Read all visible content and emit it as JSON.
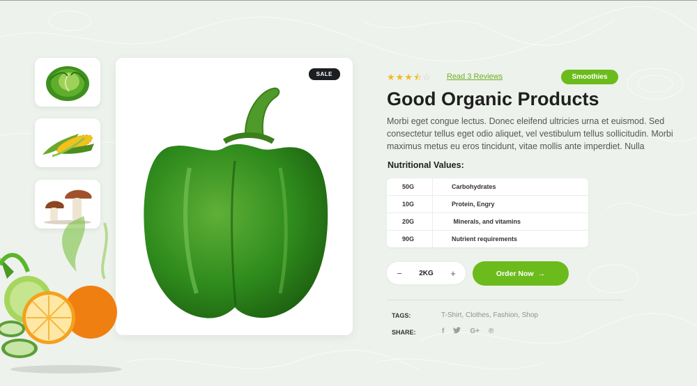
{
  "product": {
    "badge": "SALE",
    "reviews_link": "Read 3 Reviews",
    "rating": 3.5,
    "category": "Smoothies",
    "title": "Good Organic Products",
    "description": "Morbi eget congue lectus. Donec eleifend ultricies urna et euismod. Sed consectetur tellus eget odio aliquet, vel vestibulum tellus sollicitudin. Morbi maximus metus eu eros tincidunt, vitae mollis ante imperdiet. Nulla"
  },
  "thumbnails": [
    {
      "icon": "cabbage-icon"
    },
    {
      "icon": "corn-icon"
    },
    {
      "icon": "mushroom-icon"
    }
  ],
  "nutrition": {
    "heading": "Nutritional Values:",
    "rows": [
      {
        "amount": "50G",
        "name": "Carbohydrates"
      },
      {
        "amount": "10G",
        "name": "Protein, Engry"
      },
      {
        "amount": "20G",
        "name": " Minerals, and vitamins"
      },
      {
        "amount": "90G",
        "name": "Nutrient requirements"
      }
    ]
  },
  "purchase": {
    "minus": "−",
    "plus": "+",
    "quantity": "2KG",
    "order_label": "Order Now",
    "order_arrow": "→"
  },
  "meta": {
    "tags_label": "TAGS:",
    "tags": "T-Shirt, Clothes, Fashion, Shop",
    "share_label": "SHARE:",
    "share_icons": [
      {
        "icon": "facebook-icon",
        "glyph": "f"
      },
      {
        "icon": "twitter-icon",
        "glyph": "🐦"
      },
      {
        "icon": "google-plus-icon",
        "glyph": "G+"
      },
      {
        "icon": "pinterest-icon",
        "glyph": "℗"
      }
    ]
  },
  "colors": {
    "accent": "#6cbb1c",
    "link": "#6cb224",
    "star": "#f4b81f",
    "badge_bg": "#1c1f22",
    "page_bg": "#edf2ec"
  }
}
